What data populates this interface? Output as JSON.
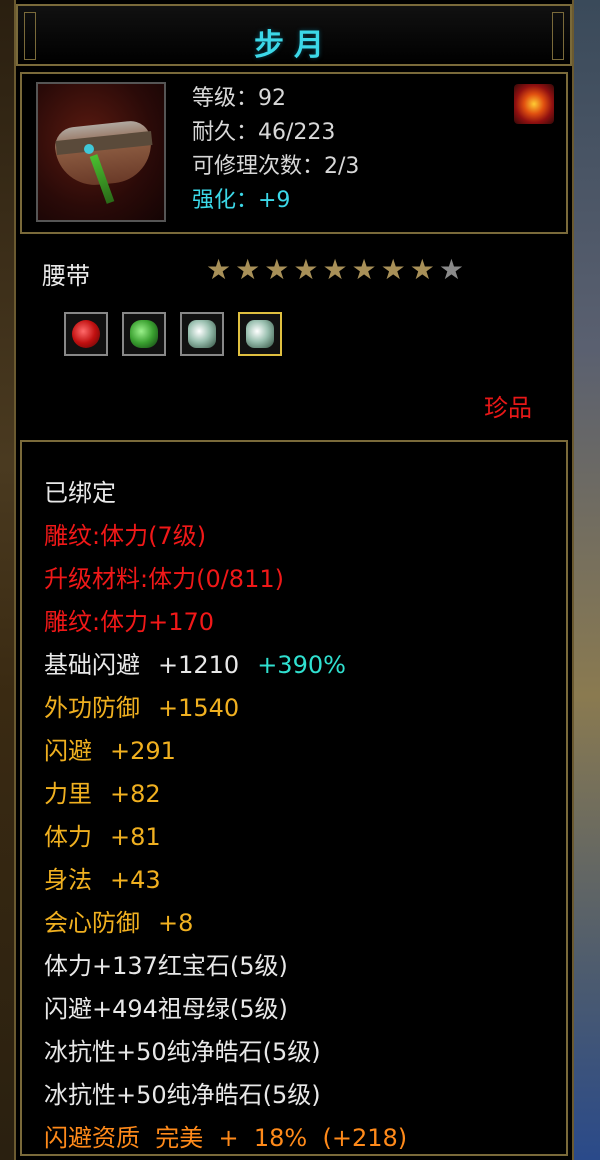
{
  "title": "步月",
  "header": {
    "level": "等级：92",
    "durability": "耐久：46/223",
    "repair": "可修理次数：2/3",
    "enhance": "强化：+9"
  },
  "item_type": "腰带",
  "stars": {
    "filled": 8,
    "total": 9
  },
  "gems": [
    "red-gem-icon",
    "green-gem-icon",
    "white-gem-icon",
    "white-gem-icon"
  ],
  "rarity": "珍品",
  "attributes": {
    "bound": "已绑定",
    "engrave1": "雕纹:体力(7级)",
    "upgrade_mat": "升级材料:体力(0/811)",
    "engrave2": "雕纹:体力+170",
    "base_dodge_label": "基础闪避",
    "base_dodge_value": "+1210",
    "base_dodge_bonus": "+390%",
    "ext_def_label": "外功防御",
    "ext_def_value": "+1540",
    "dodge_label": "闪避",
    "dodge_value": "+291",
    "strength_label": "力里",
    "strength_value": "+82",
    "stamina_label": "体力",
    "stamina_value": "+81",
    "agility_label": "身法",
    "agility_value": "+43",
    "crit_def_label": "会心防御",
    "crit_def_value": "+8",
    "gem1": "体力+137红宝石(5级)",
    "gem2": "闪避+494祖母绿(5级)",
    "gem3": "冰抗性+50纯净皓石(5级)",
    "gem4": "冰抗性+50纯净皓石(5级)",
    "quality": "闪避资质  完美  +  18%  (+218)"
  }
}
